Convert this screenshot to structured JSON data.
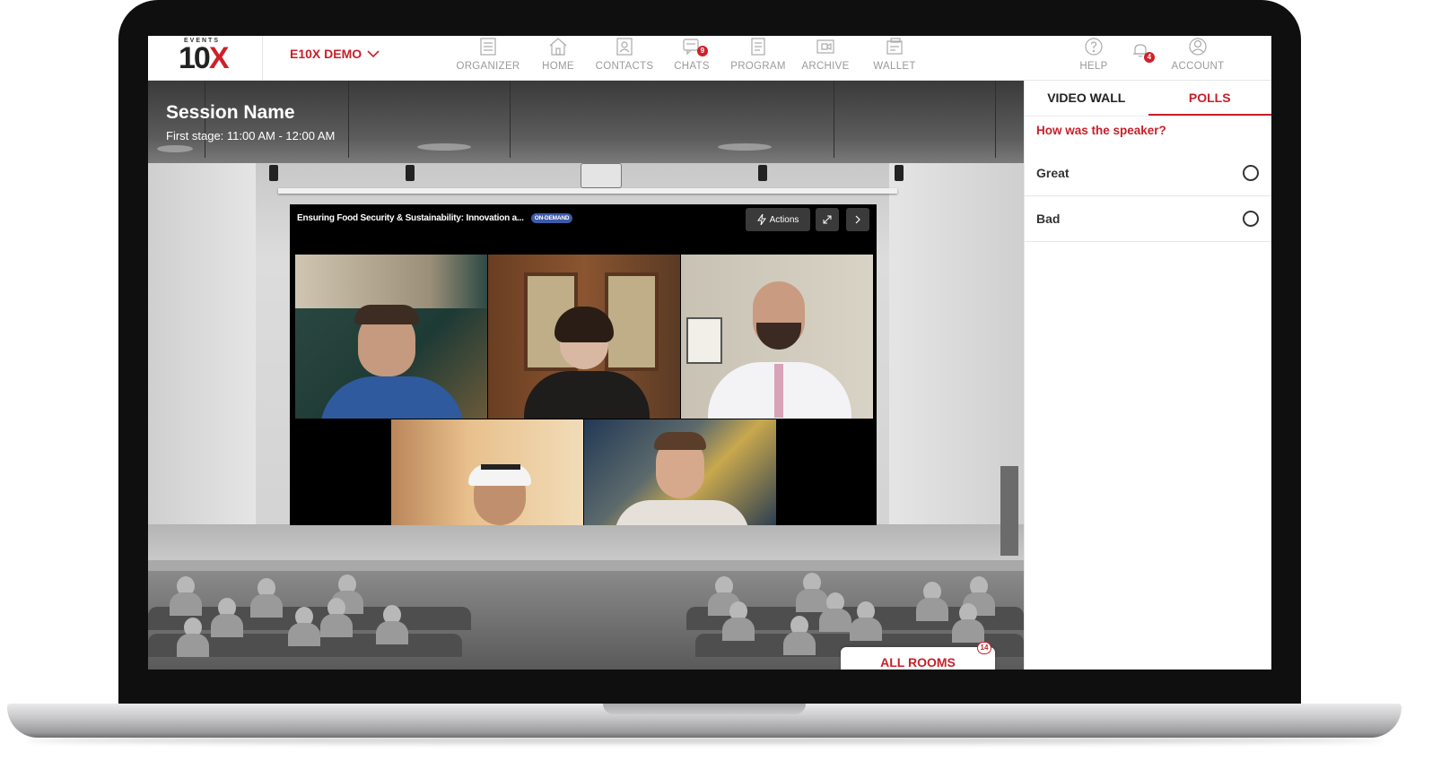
{
  "nav": {
    "event_name": "E10X DEMO",
    "logo_top": "EVENTS",
    "logo_main": "10",
    "logo_x": "X",
    "items": [
      {
        "label": "ORGANIZER",
        "icon": "organizer-icon"
      },
      {
        "label": "HOME",
        "icon": "home-icon"
      },
      {
        "label": "CONTACTS",
        "icon": "contacts-icon"
      },
      {
        "label": "CHATS",
        "icon": "chat-icon",
        "badge": "9"
      },
      {
        "label": "PROGRAM",
        "icon": "program-icon"
      },
      {
        "label": "ARCHIVE",
        "icon": "archive-icon"
      },
      {
        "label": "WALLET",
        "icon": "wallet-icon"
      }
    ],
    "help_label": "HELP",
    "notification_badge": "4",
    "account_label": "ACCOUNT"
  },
  "session": {
    "name": "Session Name",
    "time": "First stage: 11:00 AM - 12:00 AM"
  },
  "video": {
    "title": "Ensuring Food Security & Sustainability: Innovation a...",
    "status_tag": "ON-DEMAND",
    "actions_label": "Actions"
  },
  "rooms": {
    "label": "ALL ROOMS",
    "count": "14"
  },
  "panel": {
    "tabs": [
      {
        "label": "VIDEO WALL",
        "active": false
      },
      {
        "label": "POLLS",
        "active": true
      }
    ],
    "poll_question": "How was the speaker?",
    "options": [
      "Great",
      "Bad"
    ]
  },
  "colors": {
    "accent": "#c8202a",
    "nav_text": "#9a9a9a"
  }
}
